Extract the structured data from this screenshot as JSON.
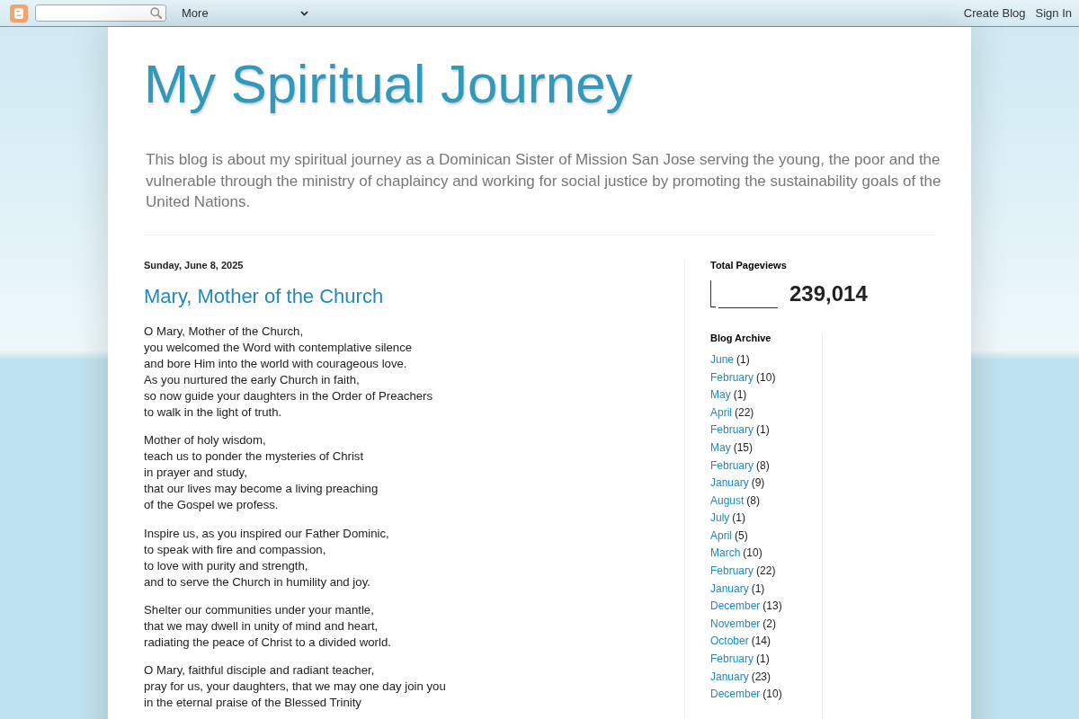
{
  "navbar": {
    "menu": {
      "label": "More"
    },
    "links": [
      "Create Blog",
      "Sign In"
    ]
  },
  "header": {
    "title": "My Spiritual Journey",
    "description": "This blog is about my spiritual journey as a Dominican Sister of Mission San Jose serving the young, the poor and the vulnerable through the ministry of chaplaincy and working for social justice by promoting the sustainability goals of the United Nations."
  },
  "post": {
    "date": "Sunday, June 8, 2025",
    "title": "Mary, Mother of the Church",
    "stanzas": [
      [
        "O Mary, Mother of the Church,",
        "you welcomed the Word with contemplative silence",
        "and bore Him into the world with courageous love.",
        "As you nurtured the early Church in faith,",
        "so now guide your daughters in the Order of Preachers",
        "to walk in the light of truth."
      ],
      [
        "Mother of holy wisdom,",
        "teach us to ponder the mysteries of Christ",
        "in prayer and study,",
        "that our lives may become a living preaching",
        "of the Gospel we profess."
      ],
      [
        "Inspire us, as you inspired our Father Dominic,",
        "to speak with fire and compassion,",
        "to love with purity and strength,",
        "and to serve the Church in humility and joy."
      ],
      [
        "Shelter our communities under your mantle,",
        "that we may dwell in unity of mind and heart,",
        "radiating the peace of Christ to a divided world."
      ],
      [
        "O Mary, faithful disciple and radiant teacher,",
        "pray for us, your daughters, that we may one day join you",
        "in the eternal praise of the Blessed Trinity"
      ]
    ]
  },
  "sidebar": {
    "pageviews": {
      "heading": "Total Pageviews",
      "count": "239,014"
    },
    "archive": {
      "heading": "Blog Archive",
      "items": [
        {
          "month": "June",
          "count": "(1)"
        },
        {
          "month": "February",
          "count": "(10)"
        },
        {
          "month": "May",
          "count": "(1)"
        },
        {
          "month": "April",
          "count": "(22)"
        },
        {
          "month": "February",
          "count": "(1)"
        },
        {
          "month": "May",
          "count": "(15)"
        },
        {
          "month": "February",
          "count": "(8)"
        },
        {
          "month": "January",
          "count": "(9)"
        },
        {
          "month": "August",
          "count": "(8)"
        },
        {
          "month": "July",
          "count": "(1)"
        },
        {
          "month": "April",
          "count": "(5)"
        },
        {
          "month": "March",
          "count": "(10)"
        },
        {
          "month": "February",
          "count": "(22)"
        },
        {
          "month": "January",
          "count": "(1)"
        },
        {
          "month": "December",
          "count": "(13)"
        },
        {
          "month": "November",
          "count": "(2)"
        },
        {
          "month": "October",
          "count": "(14)"
        },
        {
          "month": "February",
          "count": "(1)"
        },
        {
          "month": "January",
          "count": "(23)"
        },
        {
          "month": "December",
          "count": "(10)"
        }
      ]
    }
  }
}
